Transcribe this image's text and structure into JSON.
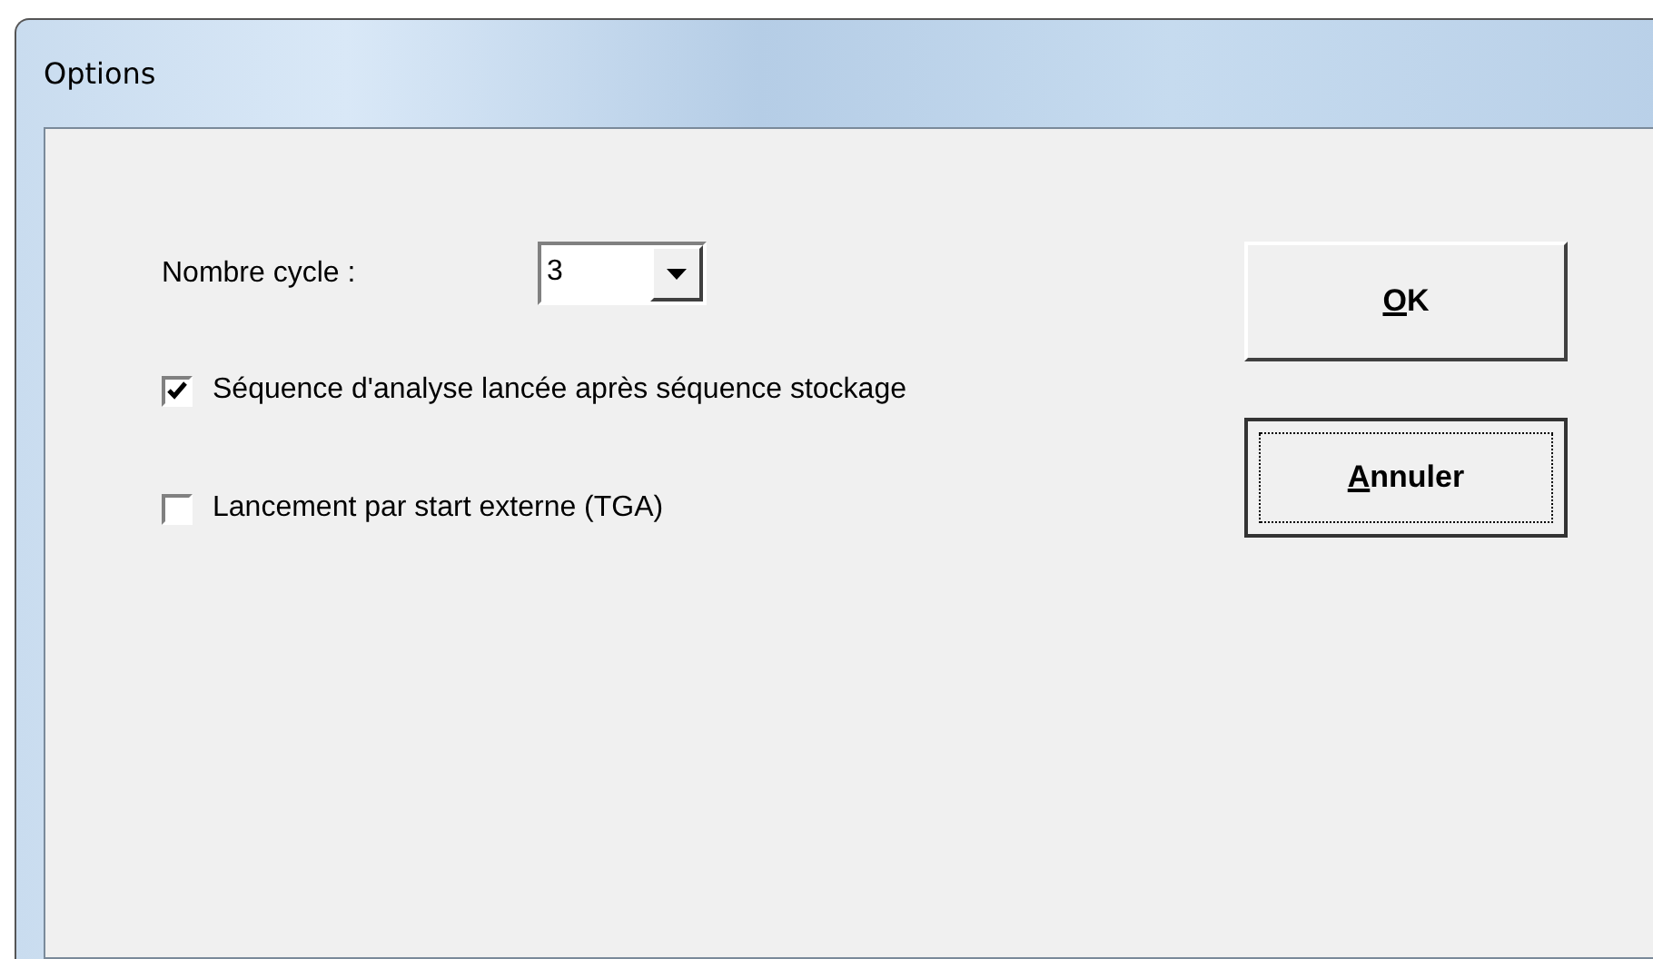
{
  "window": {
    "title": "Options"
  },
  "cycle_field": {
    "label": "Nombre cycle :",
    "value": "3"
  },
  "checkboxes": [
    {
      "label": "Séquence d'analyse lancée après séquence stockage",
      "checked": true
    },
    {
      "label": "Lancement par start externe (TGA)",
      "checked": false
    }
  ],
  "buttons": [
    {
      "label": "OK",
      "focused": false,
      "underline_first": true
    },
    {
      "label": "Annuler",
      "focused": true,
      "underline_first": true
    }
  ]
}
